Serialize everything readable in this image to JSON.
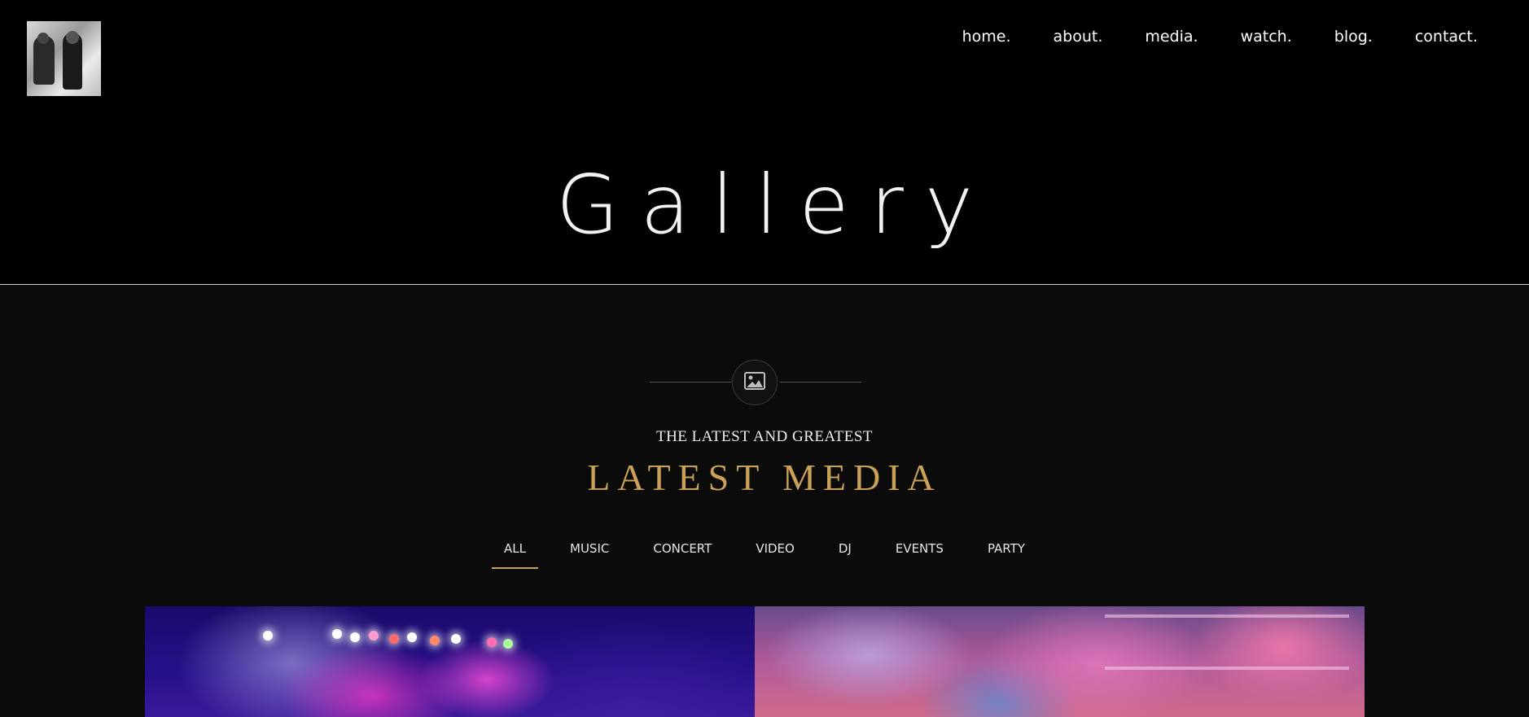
{
  "header": {
    "nav": [
      "home.",
      "about.",
      "media.",
      "watch.",
      "blog.",
      "contact."
    ],
    "page_title": "Gallery"
  },
  "section": {
    "icon": "image-icon",
    "subtitle": "THE LATEST AND GREATEST",
    "title": "LATEST MEDIA",
    "accent_color": "#c9a257"
  },
  "filters": {
    "items": [
      "ALL",
      "MUSIC",
      "CONCERT",
      "VIDEO",
      "DJ",
      "EVENTS",
      "PARTY"
    ],
    "active": "ALL"
  }
}
